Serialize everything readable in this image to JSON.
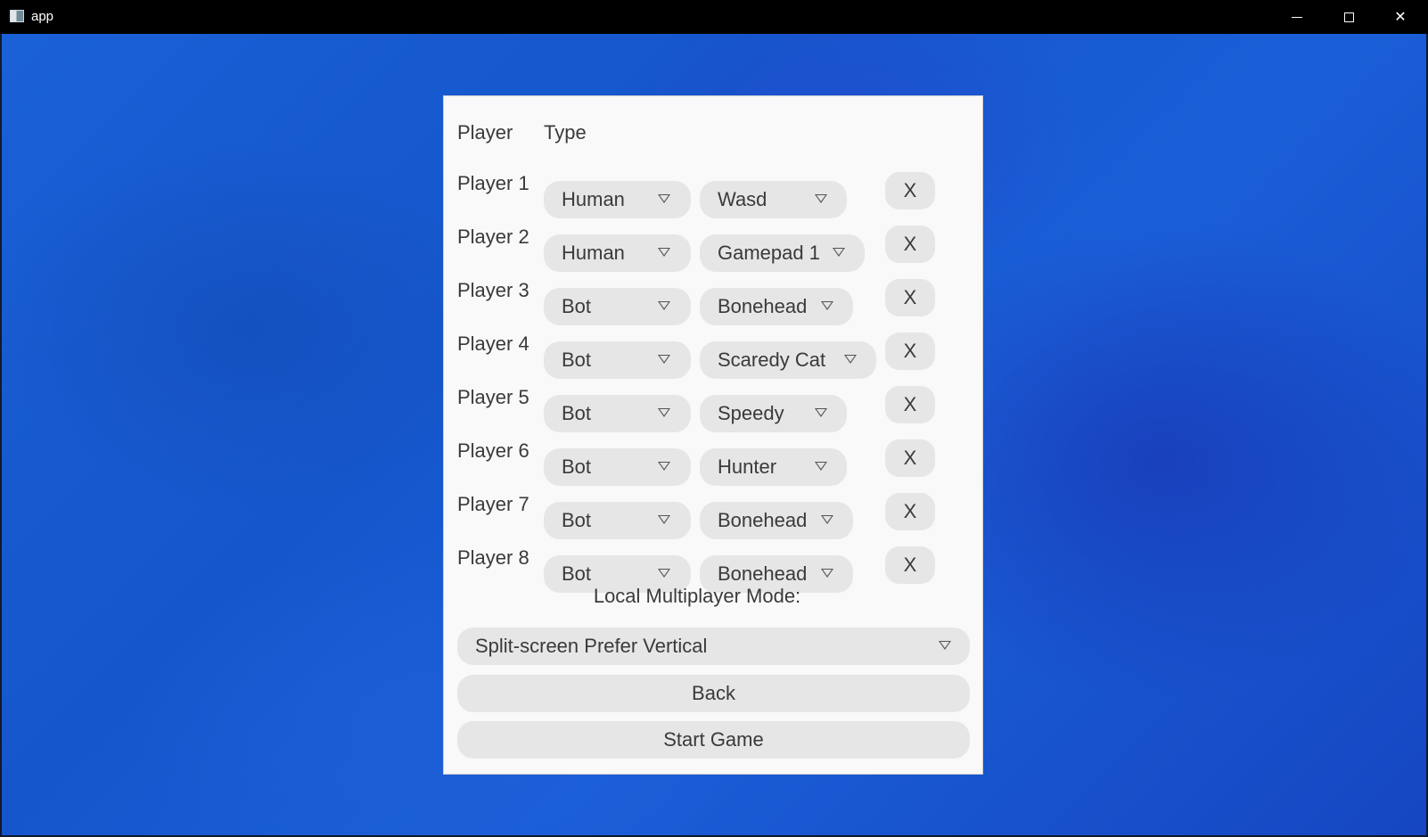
{
  "window": {
    "title": "app",
    "minimize_icon": "minimize-icon",
    "maximize_icon": "maximize-icon",
    "close_glyph": "✕"
  },
  "table": {
    "header_player": "Player",
    "header_type": "Type"
  },
  "players": [
    {
      "label": "Player 1",
      "type": "Human",
      "option": "Wasd",
      "remove": "X"
    },
    {
      "label": "Player 2",
      "type": "Human",
      "option": "Gamepad 1",
      "remove": "X"
    },
    {
      "label": "Player 3",
      "type": "Bot",
      "option": "Bonehead",
      "remove": "X"
    },
    {
      "label": "Player 4",
      "type": "Bot",
      "option": "Scaredy Cat",
      "remove": "X"
    },
    {
      "label": "Player 5",
      "type": "Bot",
      "option": "Speedy",
      "remove": "X"
    },
    {
      "label": "Player 6",
      "type": "Bot",
      "option": "Hunter",
      "remove": "X"
    },
    {
      "label": "Player 7",
      "type": "Bot",
      "option": "Bonehead",
      "remove": "X"
    },
    {
      "label": "Player 8",
      "type": "Bot",
      "option": "Bonehead",
      "remove": "X"
    }
  ],
  "mode": {
    "label": "Local Multiplayer Mode:",
    "value": "Split-screen Prefer Vertical"
  },
  "buttons": {
    "back": "Back",
    "start": "Start Game"
  },
  "colors": {
    "background_blue": "#1a5fd8",
    "panel": "#f9f9f9",
    "control": "#e6e6e6",
    "text": "#3a3a3a"
  }
}
